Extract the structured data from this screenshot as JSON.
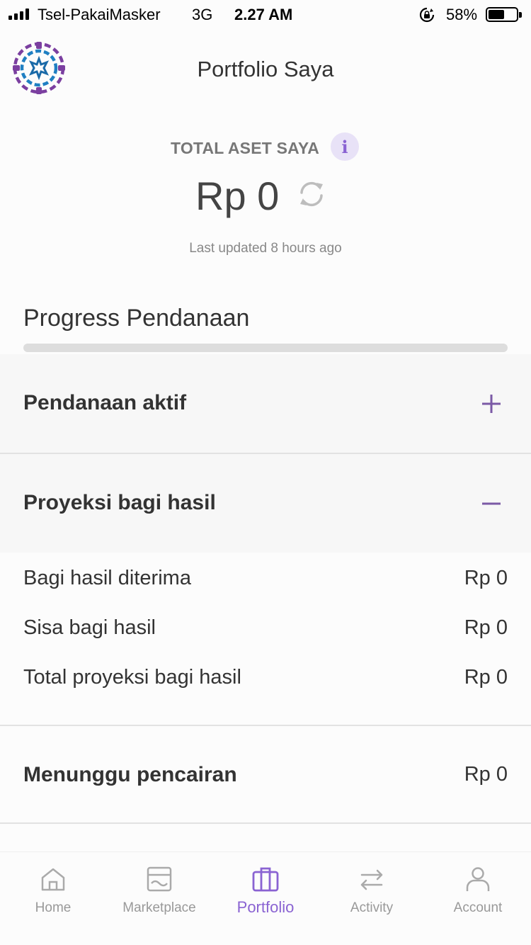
{
  "status_bar": {
    "carrier": "Tsel-PakaiMasker",
    "network": "3G",
    "time": "2.27 AM",
    "battery_percent": "58%",
    "battery_level": 0.58
  },
  "header": {
    "title": "Portfolio Saya",
    "logo_icon": "ornament-logo-icon"
  },
  "total_assets": {
    "label": "TOTAL ASET SAYA",
    "info_symbol": "i",
    "value": "Rp 0",
    "last_updated": "Last updated 8 hours ago"
  },
  "progress": {
    "title": "Progress Pendanaan",
    "fill_percent": 0
  },
  "sections": {
    "active_funding": {
      "title": "Pendanaan aktif",
      "icon": "plus-icon"
    },
    "profit_projection": {
      "title": "Proyeksi bagi hasil",
      "icon": "minus-icon",
      "rows": [
        {
          "label": "Bagi hasil diterima",
          "value": "Rp 0"
        },
        {
          "label": "Sisa bagi hasil",
          "value": "Rp 0"
        },
        {
          "label": "Total proyeksi bagi hasil",
          "value": "Rp 0"
        }
      ]
    },
    "pending_disbursement": {
      "title": "Menunggu pencairan",
      "value": "Rp 0"
    }
  },
  "bottom_nav": [
    {
      "label": "Home",
      "icon": "home-icon"
    },
    {
      "label": "Marketplace",
      "icon": "marketplace-icon"
    },
    {
      "label": "Portfolio",
      "icon": "portfolio-icon",
      "active": true
    },
    {
      "label": "Activity",
      "icon": "activity-icon"
    },
    {
      "label": "Account",
      "icon": "account-icon"
    }
  ],
  "colors": {
    "accent": "#8a63d2",
    "logo_purple": "#7b3fa0",
    "logo_blue": "#1f7fc2",
    "inactive": "#999999"
  }
}
